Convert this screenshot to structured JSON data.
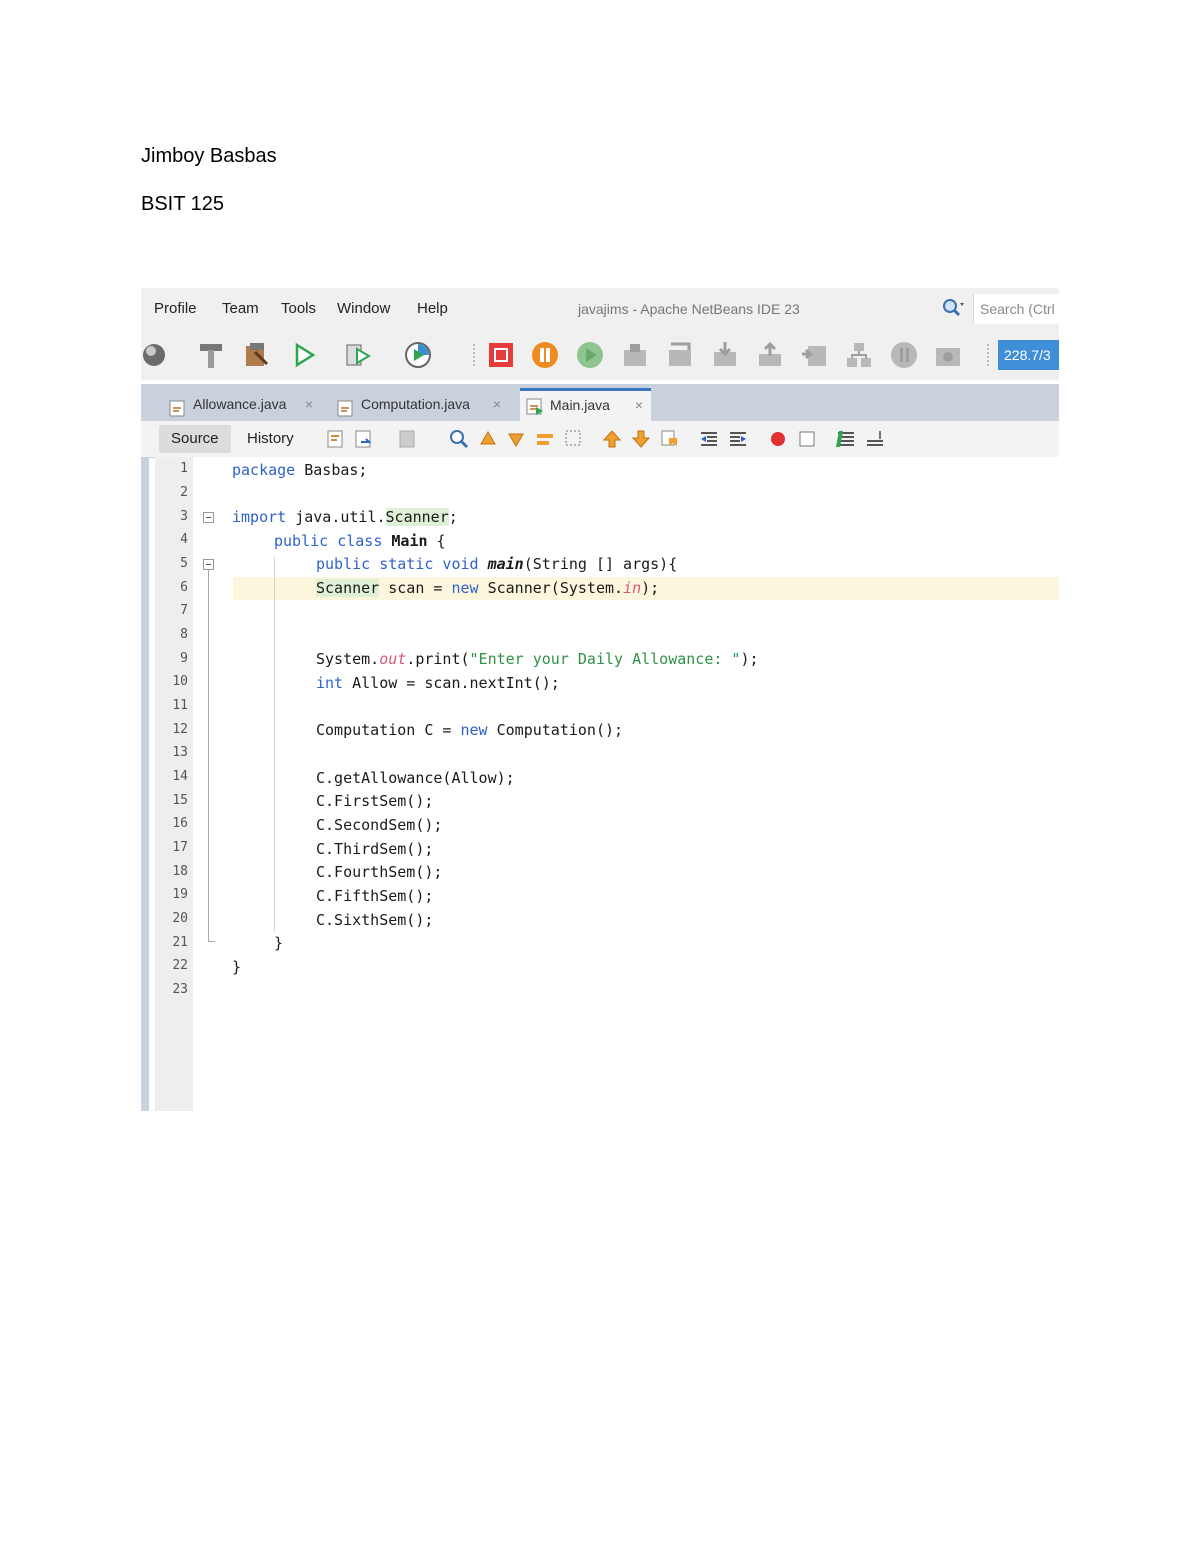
{
  "document": {
    "name": "Jimboy Basbas",
    "course": "BSIT 125"
  },
  "ide": {
    "menu": [
      "Profile",
      "Team",
      "Tools",
      "Window",
      "Help"
    ],
    "title": "javajims - Apache NetBeans IDE 23",
    "search_placeholder": "Search (Ctrl",
    "memory": "228.7/3",
    "tabs": [
      {
        "label": "Allowance.java",
        "close": "×",
        "active": false
      },
      {
        "label": "Computation.java",
        "close": "×",
        "active": false
      },
      {
        "label": "Main.java",
        "close": "×",
        "active": true
      }
    ],
    "editor_tabs": {
      "source": "Source",
      "history": "History"
    },
    "line_numbers": [
      "1",
      "2",
      "3",
      "4",
      "5",
      "6",
      "7",
      "8",
      "9",
      "10",
      "11",
      "12",
      "13",
      "14",
      "15",
      "16",
      "17",
      "18",
      "19",
      "20",
      "21",
      "22",
      "23"
    ],
    "code": {
      "l1_kw": "package",
      "l1_rest": " Basbas;",
      "l3_kw": "import",
      "l3_pkg": " java.util.",
      "l3_cls": "Scanner",
      "l3_end": ";",
      "l4_kw": "public class",
      "l4_name": " Main",
      "l4_end": " {",
      "l5_kw": "public static void",
      "l5_name": " main",
      "l5_rest": "(String [] args){",
      "l6_cls": "Scanner",
      "l6_mid": " scan = ",
      "l6_new": "new",
      "l6_rest": " Scanner(System.",
      "l6_in": "in",
      "l6_end": ");",
      "l9_a": "System.",
      "l9_out": "out",
      "l9_b": ".print(",
      "l9_str": "\"Enter your Daily Allowance: \"",
      "l9_end": ");",
      "l10_kw": "int",
      "l10_rest": " Allow = scan.nextInt();",
      "l12_a": "Computation C = ",
      "l12_new": "new",
      "l12_b": " Computation();",
      "l14": "C.getAllowance(Allow);",
      "l15": "C.FirstSem();",
      "l16": "C.SecondSem();",
      "l17": "C.ThirdSem();",
      "l18": "C.FourthSem();",
      "l19": "C.FifthSem();",
      "l20": "C.SixthSem();",
      "l21": "}",
      "l22": "}"
    }
  },
  "colors": {
    "keyword": "#2f62c9",
    "string": "#2e9346",
    "field": "#d65a7a",
    "active_tab_accent": "#3875c2",
    "current_line": "#fbf6dc"
  }
}
